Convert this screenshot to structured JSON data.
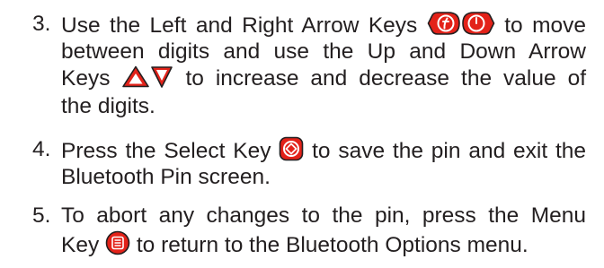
{
  "steps": [
    {
      "number": "3.",
      "lines": {
        "l1a": "Use the Left and Right Arrow Keys",
        "l1b": "to move",
        "l2": "between digits and use the Up and Down Arrow",
        "l3a": "Keys",
        "l3b": "to increase and decrease the value of",
        "l4": "the digits."
      },
      "icons": [
        "left-arrow-key-icon",
        "right-arrow-key-icon",
        "up-arrow-key-icon",
        "down-arrow-key-icon"
      ]
    },
    {
      "number": "4.",
      "lines": {
        "l1a": "Press the Select Key",
        "l1b": "to save the pin and exit the",
        "l2": "Bluetooth Pin screen."
      },
      "icons": [
        "select-key-icon"
      ]
    },
    {
      "number": "5.",
      "lines": {
        "l1": "To abort any changes to the pin, press the Menu",
        "l2a": "Key",
        "l2b": "to return to the Bluetooth Options menu."
      },
      "icons": [
        "menu-key-icon"
      ]
    }
  ],
  "colors": {
    "text": "#231f20",
    "key_red": "#e32219",
    "key_outline": "#231f20"
  }
}
